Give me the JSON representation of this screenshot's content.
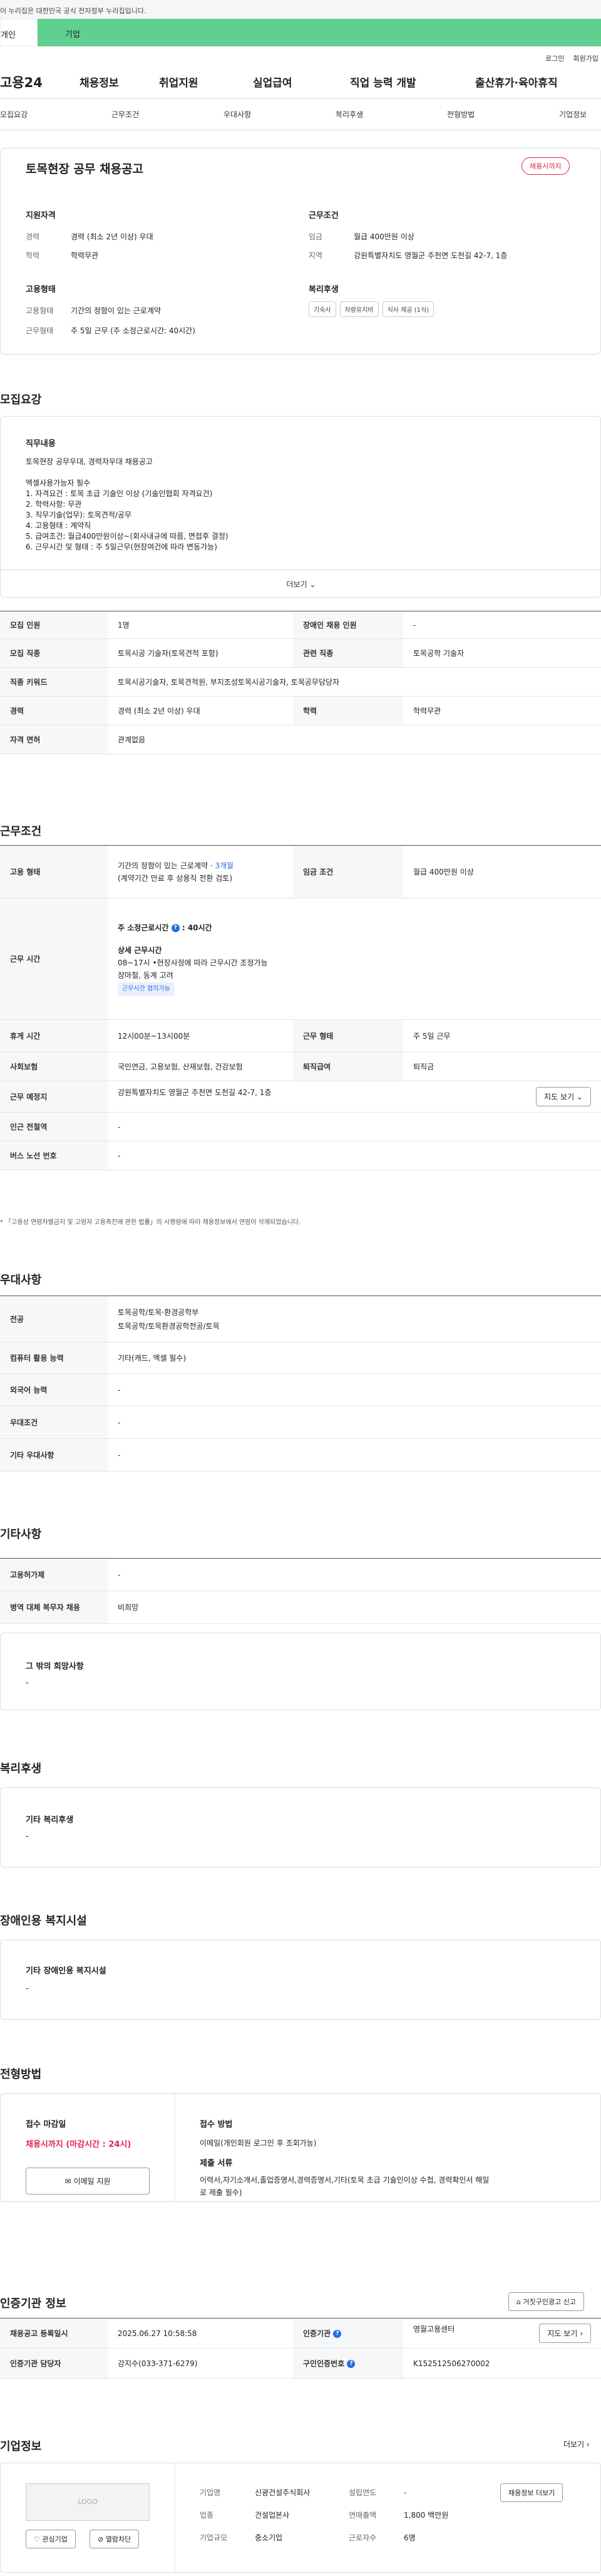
{
  "gov_notice": "이 누리집은 대한민국 공식 전자정부 누리집입니다.",
  "tabs": [
    "개인",
    "기업"
  ],
  "util": [
    "로그인",
    "회원가입"
  ],
  "gnb": {
    "logo": "고용24",
    "menus": [
      "채용정보",
      "취업지원",
      "실업급여",
      "직업 능력 개발",
      "출산휴가·육아휴직"
    ]
  },
  "subnav": [
    "모집요강",
    "근무조건",
    "우대사항",
    "복리후생",
    "전형방법",
    "기업정보"
  ],
  "summary": {
    "title": "토목현장 공무 채용공고",
    "badge": "채용시까지",
    "qual": {
      "h": "지원자격",
      "career_k": "경력",
      "career_v": "경력 (최소 2년 이상) 우대",
      "edu_k": "학력",
      "edu_v": "학력무관"
    },
    "cond": {
      "h": "근무조건",
      "pay_k": "임금",
      "pay_v": "월급 400만원 이상",
      "loc_k": "지역",
      "loc_v": "강원특별자치도 영월군 주천면 도천길 42-7, 1층"
    },
    "emp": {
      "h": "고용형태",
      "type_k": "고용형태",
      "type_v": "기간의 정함이 있는 근로계약",
      "work_k": "근무형태",
      "work_v": "주 5일 근무 (주 소정근로시간: 40시간)"
    },
    "welfare": {
      "h": "복리후생",
      "chips": [
        "기숙사",
        "차량유지비",
        "식사 제공 (1식)"
      ]
    }
  },
  "recruit": {
    "h": "모집요강",
    "duty_h": "직무내용",
    "duty_lines": [
      "토목현장 공무우대, 경력자우대 채용공고",
      "",
      "엑셀사용가능자 필수",
      "1. 자격요건 : 토목 초급 기술인 이상 (기술인협회 자격요건)",
      "2. 학력사항: 무관",
      "3. 직무기술(업무): 토목견적/공무",
      "4. 고용형태 : 계약직",
      "5. 급여조건: 월급400만원이상~(회사내규에 따름, 면접후 결정)",
      "6. 근무시간 및 형태 : 주 5일근무(현장여건에 따라 변동가능)"
    ],
    "more": "더보기",
    "rows": [
      {
        "k": "모집 인원",
        "v": "1명",
        "k2": "장애인 채용 인원",
        "v2": "-"
      },
      {
        "k": "모집 직종",
        "v": "토목시공 기술자(토목견적 포함)",
        "k2": "관련 직종",
        "v2": "토목공학 기술자"
      },
      {
        "k": "직종 키워드",
        "v": "토목시공기술자, 토목견적원, 부지조성토목시공기술자, 토목공무담당자"
      },
      {
        "k": "경력",
        "v": "경력 (최소 2년 이상) 우대",
        "k2": "학력",
        "v2": "학력무관"
      },
      {
        "k": "자격 면허",
        "v": "관계없음"
      }
    ]
  },
  "conditions": {
    "h": "근무조건",
    "emp_k": "고용 형태",
    "emp_v1": "기간의 정함이 있는 근로계약 · ",
    "emp_v1b": "3개월",
    "emp_v2": "(계약기간 만료 후 상용직 전환 검토)",
    "pay_k": "임금 조건",
    "pay_v": "월급 400만원 이상",
    "time_k": "근무 시간",
    "time_weekly": "주 소정근로시간",
    "time_hours": "40시간",
    "time_detail_h": "상세 근무시간",
    "time_detail_1": "08~17시 •현장사정에 따라 근무시간 조정가능",
    "time_detail_2": "장마철, 동계 고려",
    "time_tag": "근무시간 협의가능",
    "break_k": "휴게 시간",
    "break_v": "12시00분~13시00분",
    "form_k": "근무 형태",
    "form_v": "주 5일 근무",
    "ins_k": "사회보험",
    "ins_v": "국민연금, 고용보험, 산재보험, 건강보험",
    "ret_k": "퇴직급여",
    "ret_v": "퇴직금",
    "place_k": "근무 예정지",
    "place_v": "강원특별자치도 영월군 주천면 도천길 42-7, 1층",
    "map_btn": "지도 보기",
    "subway_k": "인근 전철역",
    "subway_v": "-",
    "bus_k": "버스 노선 번호",
    "bus_v": "-",
    "note": "* 「고용상 연령차별금지 및 고령자 고용촉진에 관한 법률」의 시행령에 따라 채용정보에서 연령이 삭제되었습니다."
  },
  "pref": {
    "h": "우대사항",
    "rows": [
      {
        "k": "전공",
        "v": [
          "토목공학/토목·환경공학부",
          "토목공학/토목환경공학전공/토목"
        ]
      },
      {
        "k": "컴퓨터 활용 능력",
        "v": [
          "기타(캐드, 엑셀 필수)"
        ]
      },
      {
        "k": "외국어 능력",
        "v": [
          "-"
        ]
      },
      {
        "k": "우대조건",
        "v": [
          "-"
        ]
      },
      {
        "k": "기타 우대사항",
        "v": [
          "-"
        ]
      }
    ]
  },
  "etc": {
    "h": "기타사항",
    "rows": [
      {
        "k": "고용허가제",
        "v": "-"
      },
      {
        "k": "병역 대체 복무자 채용",
        "v": "비희망"
      }
    ],
    "hope_h": "그 밖의 희망사항",
    "hope_v": "-"
  },
  "welfare": {
    "h": "복리후생",
    "box_h": "기타 복리후생",
    "box_v": "-"
  },
  "disab": {
    "h": "장애인용 복지시설",
    "box_h": "기타 장애인용 복지시설",
    "box_v": "-"
  },
  "process": {
    "h": "전형방법",
    "deadline_h": "접수 마감일",
    "deadline_v": "채용시까지 (마감시간 : 24시)",
    "email_btn": "이메일 지원",
    "method_h": "접수 방법",
    "method_v": "이메일(개인회원 로그인 후 조회가능)",
    "docs_h": "제출 서류",
    "docs_v1": "이력서,자기소개서,졸업증명서,경력증명서,기타(토목 초급 기술인이상 수첩, 경력확인서  해일",
    "docs_v2": "로 제출 필수)"
  },
  "cert": {
    "h": "인증기관 정보",
    "report_btn": "거짓구인광고 신고",
    "reg_k": "채용공고 등록일시",
    "reg_v": "2025.06.27 10:58:58",
    "org_k": "인증기관",
    "org_v": "영월고용센터",
    "map_btn": "지도 보기",
    "mgr_k": "인증기관 담당자",
    "mgr_v": "강지수(033-371-6279)",
    "num_k": "구인인증번호",
    "num_v": "K152512506270002"
  },
  "company": {
    "h": "기업정보",
    "more": "더보기",
    "logo": "LOGO",
    "fav_btn": "관심기업",
    "block_btn": "열람차단",
    "info_btn": "채용정보 더보기",
    "name_k": "기업명",
    "name_v": "신광건설주식회사",
    "est_k": "설립연도",
    "est_v": "-",
    "ind_k": "업종",
    "ind_v": "건설업본사",
    "sales_k": "연매출액",
    "sales_v": "1,800 백만원",
    "size_k": "기업규모",
    "size_v": "중소기업",
    "emp_k": "근로자수",
    "emp_v": "6명"
  }
}
